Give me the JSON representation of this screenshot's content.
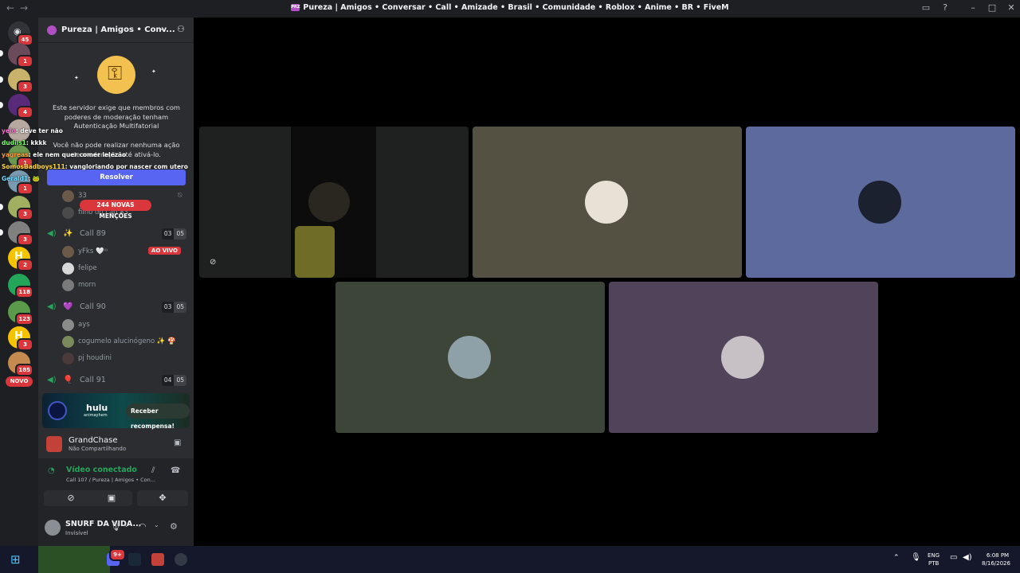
{
  "window": {
    "title": "Pureza | Amigos • Conversar • Call • Amizade • Brasil • Comunidade • Roblox • Anime • BR • FiveM",
    "server_tag": "PRZ"
  },
  "servers": [
    {
      "badge": "45",
      "color": "#5865f2"
    },
    {
      "badge": "1",
      "color": "#6b4a5c"
    },
    {
      "badge": "3",
      "color": "#c9b26a"
    },
    {
      "badge": "4",
      "color": "#5a2a7a"
    },
    {
      "badge": "",
      "color": "#b7a9a0"
    },
    {
      "badge": "1",
      "color": "#6a9a50"
    },
    {
      "badge": "1",
      "color": "#7a9ab0"
    },
    {
      "badge": "3",
      "color": "#a0b060"
    },
    {
      "badge": "3",
      "color": "#808080"
    },
    {
      "badge": "2",
      "color": "#f5c300"
    },
    {
      "badge": "118",
      "color": "#23a55a"
    },
    {
      "badge": "123",
      "color": "#5a9a4a"
    },
    {
      "badge": "3",
      "color": "#f5c300"
    },
    {
      "badge": "185",
      "color": "#c48a50"
    }
  ],
  "novo": "NOVO",
  "server_header": {
    "name": "Pureza | Amigos • Conv..."
  },
  "mfa": {
    "line1": "Este servidor exige que membros com poderes de moderação tenham Autenticação Multifatorial",
    "line2": "Você não pode realizar nenhuma ação de moderação até ativá-lo.",
    "button": "Resolver"
  },
  "mentions": "244 NOVAS MENÇÕES",
  "partial_rows": {
    "a": "33",
    "b": "filho do Lão 33"
  },
  "channels": [
    {
      "emoji": "✨",
      "name": "Call 89",
      "count_a": "03",
      "count_b": "05"
    },
    {
      "emoji": "💜",
      "name": "Call 90",
      "count_a": "03",
      "count_b": "05"
    },
    {
      "emoji": "🎈",
      "name": "Call 91",
      "count_a": "04",
      "count_b": "05"
    }
  ],
  "call89_users": [
    {
      "name": "yFks 🤍ᵎᵎᵎ",
      "live": "AO VIVO"
    },
    {
      "name": "felipe"
    },
    {
      "name": "morn"
    }
  ],
  "call90_users": [
    {
      "name": "ays"
    },
    {
      "name": "cogumelo alucinógeno ✨ 🍄"
    },
    {
      "name": "pj houdini"
    }
  ],
  "promo": {
    "brand": "hulu",
    "sub": "animayhem",
    "button": "Receber recompensa!"
  },
  "game": {
    "title": "GrandChase",
    "subtitle": "Não Compartilhando"
  },
  "voice": {
    "title": "Vídeo conectado",
    "subtitle": "Call 107 / Pureza | Amigos • Con..."
  },
  "user": {
    "name": "SNURF DA VIDA...",
    "status": "Invisível"
  },
  "chat_overlay": [
    {
      "user": "yelo",
      "text": ": deve ter não",
      "color": "#ff6bd6"
    },
    {
      "user": "dudiis1",
      "text": ": kkkk",
      "color": "#7cff6b"
    },
    {
      "user": "yagreas",
      "text": ": ele nem quer comer lelezão",
      "color": "#ff9a3c"
    },
    {
      "user": "SomosBadboys111",
      "text": ": vangloriando por nascer com utero",
      "color": "#ffd83c"
    },
    {
      "user": "Gerald1",
      "text": ": 🐸",
      "color": "#6bd8ff"
    }
  ],
  "tiles_colors": [
    "#1f2120",
    "#545143",
    "#5d6a9e",
    "#3d4438",
    "#4f4459"
  ],
  "taskbar": {
    "lang": "ENG",
    "lang2": "PTB",
    "time": "6:08 PM",
    "date": "8/16/2026",
    "notif": "9+"
  }
}
